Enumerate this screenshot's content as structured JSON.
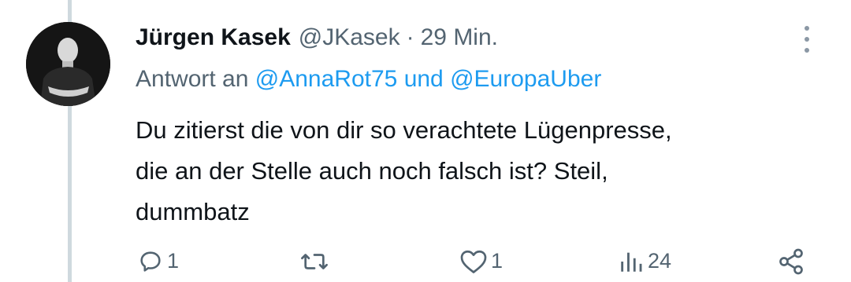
{
  "tweet": {
    "author_name": "Jürgen Kasek",
    "handle": "@JKasek",
    "separator": "·",
    "time": "29 Min.",
    "reply_prefix": "Antwort an",
    "reply_mention_1": "@AnnaRot75",
    "reply_conjunction": "und",
    "reply_mention_2": "@EuropaUber",
    "text_lines": [
      "Du zitierst die von dir so verachtete Lügenpresse,",
      "die an der Stelle auch noch falsch ist? Steil,",
      "dummbatz"
    ]
  },
  "actions": {
    "reply_count": "1",
    "retweet_count": "",
    "like_count": "1",
    "views_count": "24"
  },
  "icons": {
    "more": "more-vertical-icon",
    "reply": "reply-icon",
    "retweet": "retweet-icon",
    "like": "heart-icon",
    "views": "views-icon",
    "share": "share-icon"
  },
  "colors": {
    "text": "#0f1419",
    "secondary": "#536471",
    "link": "#1d9bf0",
    "thread_line": "#cfd9de"
  }
}
